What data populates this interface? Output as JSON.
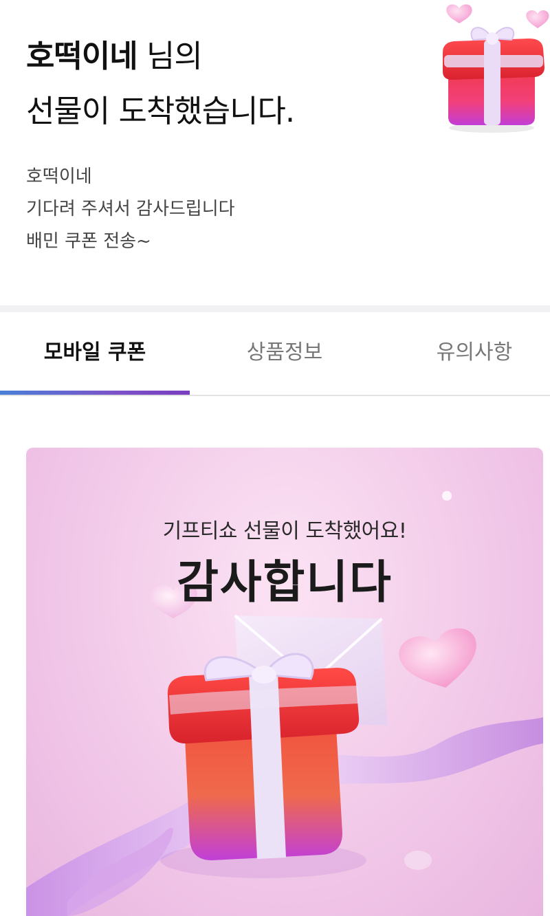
{
  "header": {
    "sender_name": "호떡이네",
    "title_suffix": " 님의",
    "title_line2": "선물이 도착했습니다.",
    "message_lines": [
      "호떡이네",
      "기다려 주셔서 감사드립니다",
      "배민 쿠폰 전송~"
    ],
    "gift_icon": "gift-box-icon"
  },
  "tabs": [
    {
      "label": "모바일 쿠폰",
      "active": true
    },
    {
      "label": "상품정보",
      "active": false
    },
    {
      "label": "유의사항",
      "active": false
    }
  ],
  "card": {
    "subtitle": "기프티쇼 선물이 도착했어요!",
    "title": "감사합니다"
  },
  "colors": {
    "tab_indicator_start": "#4a7fd8",
    "tab_indicator_end": "#7a3dbf",
    "card_background": "#f2c9e9",
    "gift_red": "#e8283a"
  }
}
